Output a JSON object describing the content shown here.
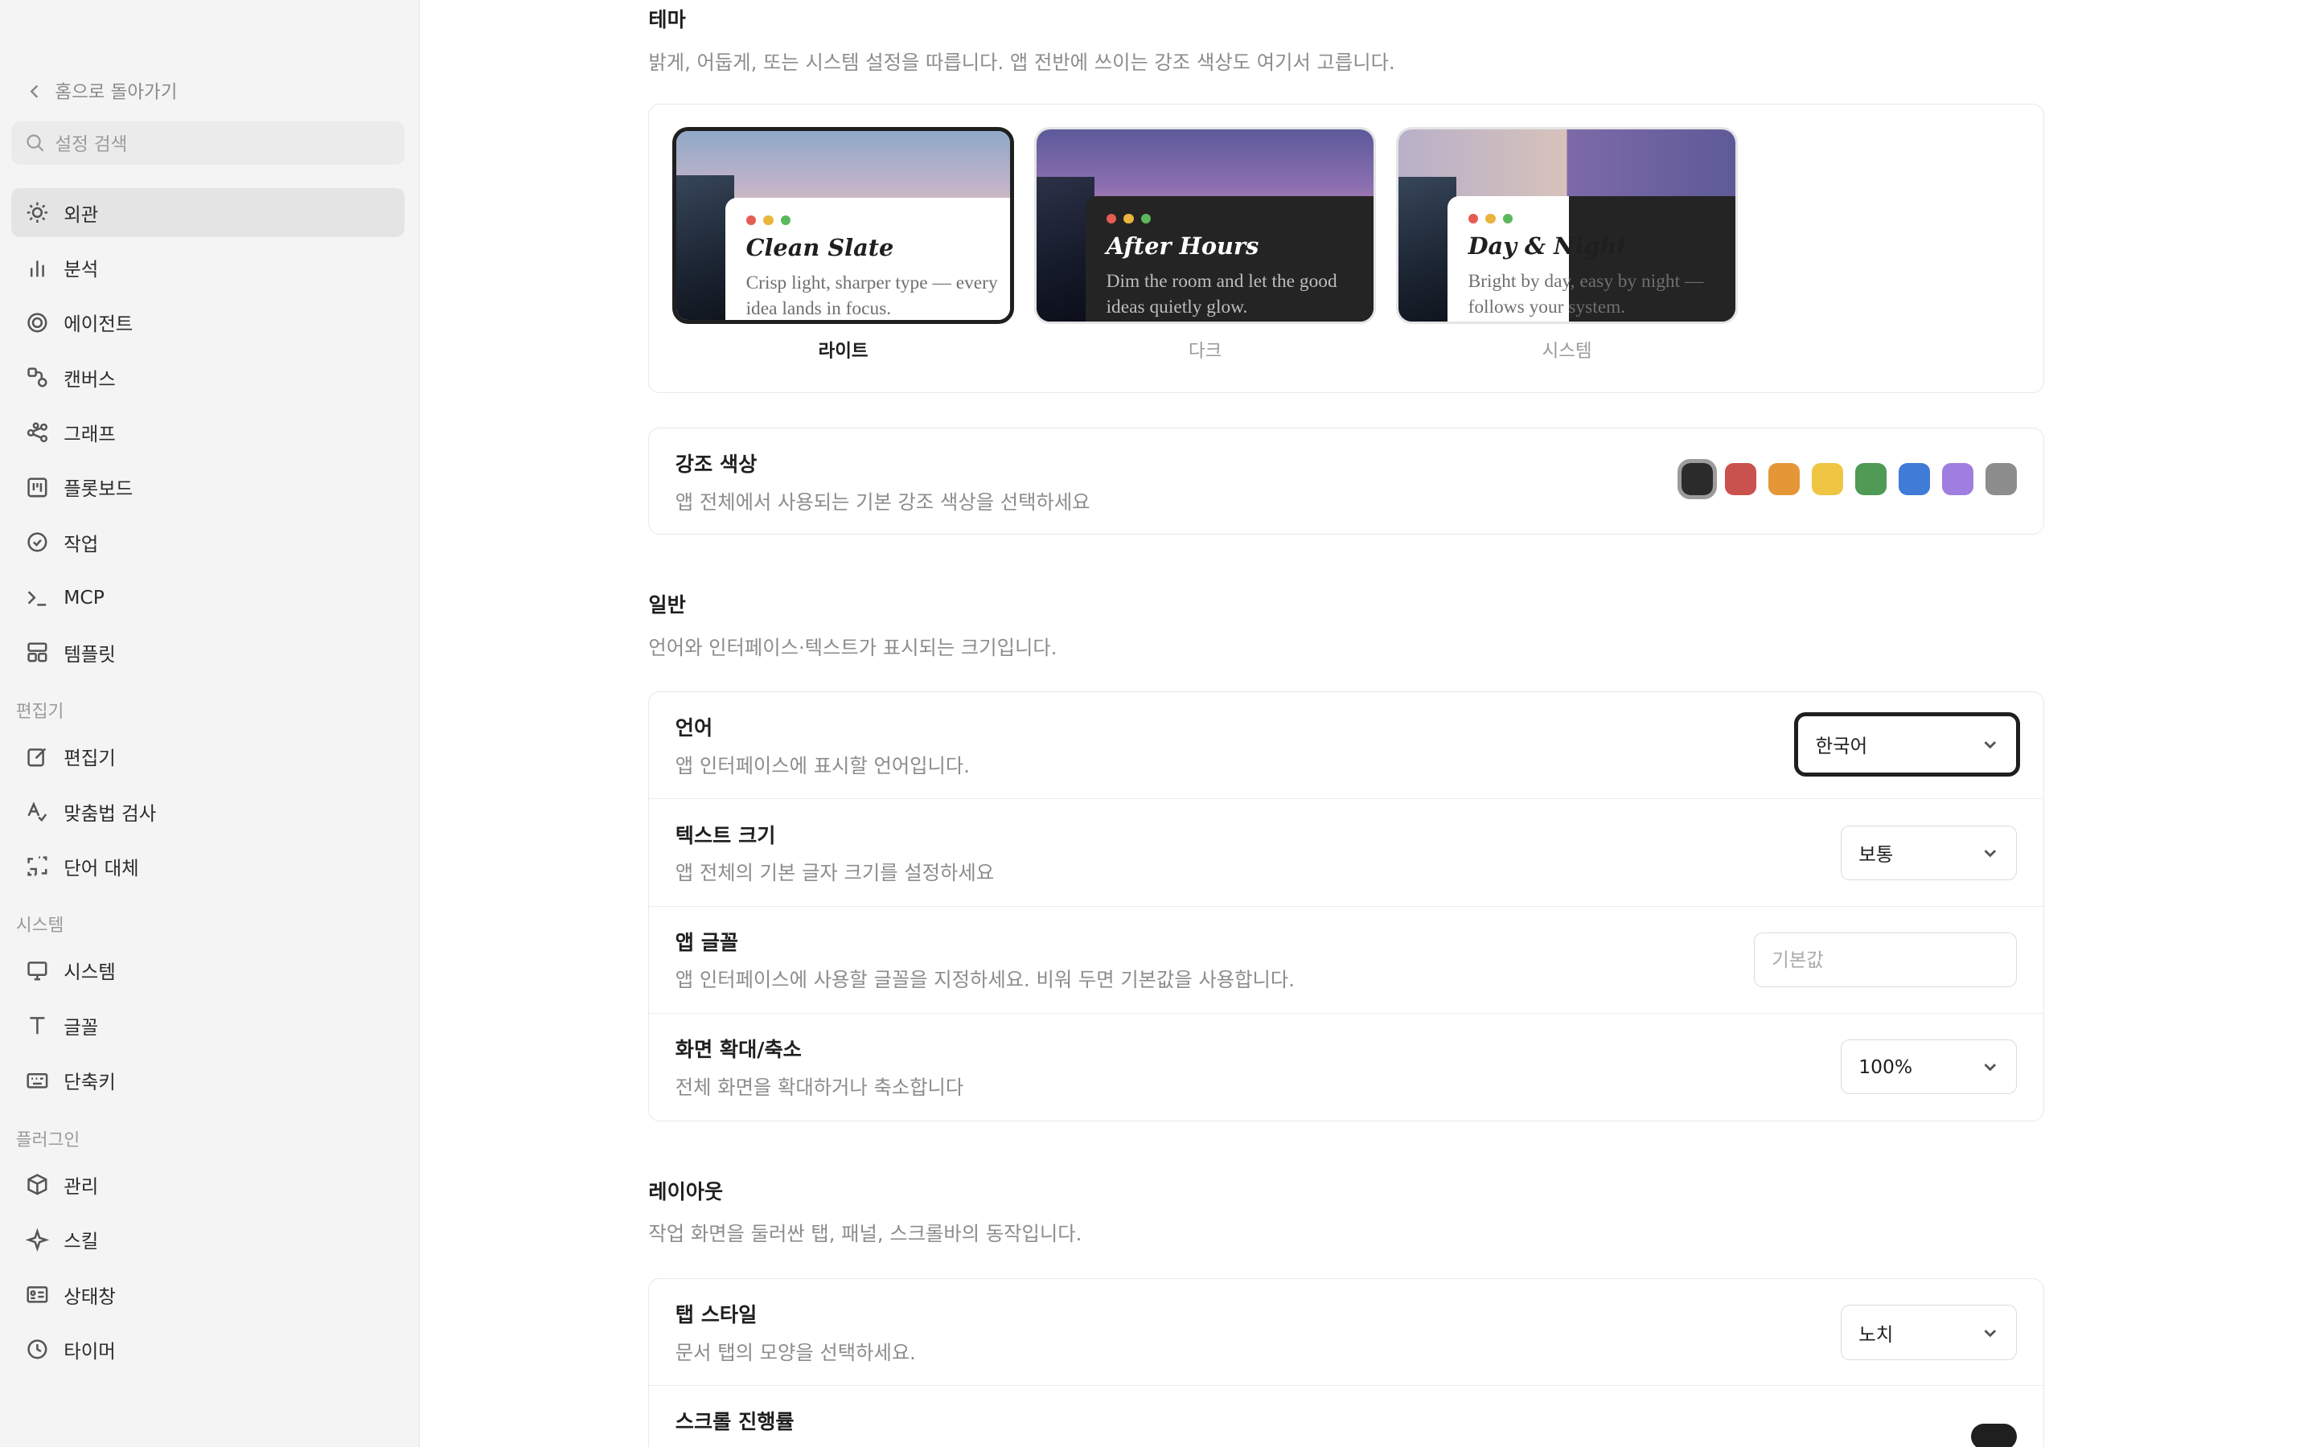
{
  "sidebar": {
    "back_label": "홈으로 돌아가기",
    "search_placeholder": "설정 검색",
    "items_main": [
      {
        "label": "외관",
        "icon": "sun-icon",
        "active": true
      },
      {
        "label": "분석",
        "icon": "bar-chart-icon"
      },
      {
        "label": "에이전트",
        "icon": "spiral-icon"
      },
      {
        "label": "캔버스",
        "icon": "canvas-icon"
      },
      {
        "label": "그래프",
        "icon": "graph-icon"
      },
      {
        "label": "플롯보드",
        "icon": "board-icon"
      },
      {
        "label": "작업",
        "icon": "check-circle-icon"
      },
      {
        "label": "MCP",
        "icon": "terminal-icon"
      },
      {
        "label": "템플릿",
        "icon": "template-icon"
      }
    ],
    "group_editor": "편집기",
    "items_editor": [
      {
        "label": "편집기",
        "icon": "edit-icon"
      },
      {
        "label": "맞춤법 검사",
        "icon": "spellcheck-icon"
      },
      {
        "label": "단어 대체",
        "icon": "replace-icon"
      }
    ],
    "group_system": "시스템",
    "items_system": [
      {
        "label": "시스템",
        "icon": "monitor-icon"
      },
      {
        "label": "글꼴",
        "icon": "font-icon"
      },
      {
        "label": "단축키",
        "icon": "keyboard-icon"
      }
    ],
    "group_plugins": "플러그인",
    "items_plugins": [
      {
        "label": "관리",
        "icon": "package-icon"
      },
      {
        "label": "스킬",
        "icon": "sparkle-icon"
      },
      {
        "label": "상태창",
        "icon": "status-card-icon"
      },
      {
        "label": "타이머",
        "icon": "clock-icon"
      }
    ]
  },
  "theme": {
    "title": "테마",
    "desc": "밝게, 어둡게, 또는 시스템 설정을 따릅니다. 앱 전반에 쓰이는 강조 색상도 여기서 고릅니다.",
    "options": [
      {
        "name": "Clean Slate",
        "text": "Crisp light, sharper type — every idea lands in focus.",
        "label": "라이트",
        "selected": true
      },
      {
        "name": "After Hours",
        "text": "Dim the room and let the good ideas quietly glow.",
        "label": "다크",
        "selected": false
      },
      {
        "name": "Day & Night",
        "text": "Bright by day, easy by night — follows your system.",
        "label": "시스템",
        "selected": false
      }
    ]
  },
  "accent": {
    "title": "강조 색상",
    "desc": "앱 전체에서 사용되는 기본 강조 색상을 선택하세요",
    "colors": [
      "#2b2b2b",
      "#c9524f",
      "#e59737",
      "#efc543",
      "#4f9a54",
      "#3f7bd7",
      "#a07ee0",
      "#8d8d8d"
    ],
    "selected_index": 0
  },
  "general": {
    "title": "일반",
    "desc": "언어와 인터페이스·텍스트가 표시되는 크기입니다.",
    "language": {
      "title": "언어",
      "desc": "앱 인터페이스에 표시할 언어입니다.",
      "value": "한국어"
    },
    "text_size": {
      "title": "텍스트 크기",
      "desc": "앱 전체의 기본 글자 크기를 설정하세요",
      "value": "보통"
    },
    "app_font": {
      "title": "앱 글꼴",
      "desc": "앱 인터페이스에 사용할 글꼴을 지정하세요. 비워 두면 기본값을 사용합니다.",
      "placeholder": "기본값"
    },
    "zoom": {
      "title": "화면 확대/축소",
      "desc": "전체 화면을 확대하거나 축소합니다",
      "value": "100%"
    }
  },
  "layout": {
    "title": "레이아웃",
    "desc": "작업 화면을 둘러싼 탭, 패널, 스크롤바의 동작입니다.",
    "tab_style": {
      "title": "탭 스타일",
      "desc": "문서 탭의 모양을 선택하세요.",
      "value": "노치"
    },
    "scroll_progress": {
      "title": "스크롤 진행률",
      "enabled": true
    }
  }
}
